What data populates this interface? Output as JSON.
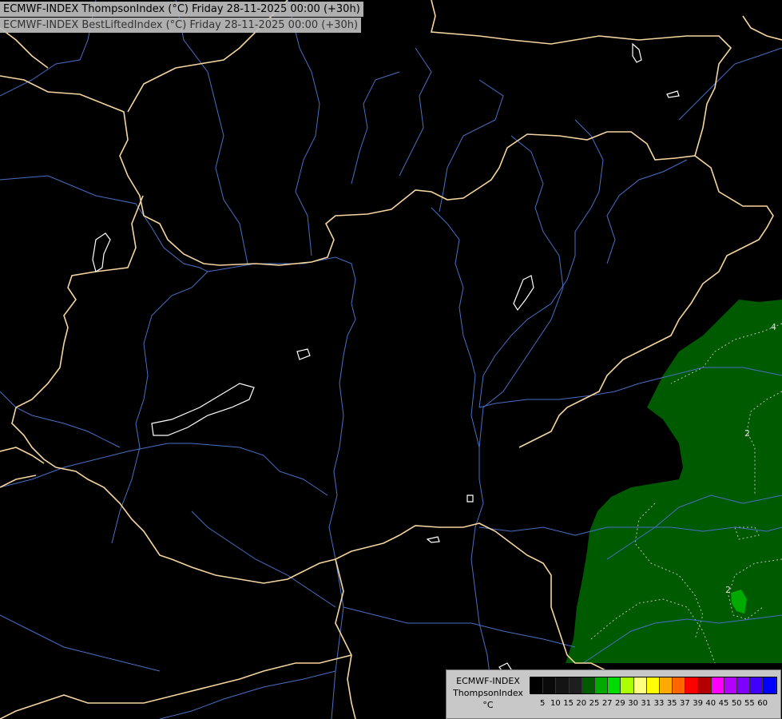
{
  "header": {
    "line1": "ECMWF-INDEX ThompsonIndex (°C) Friday 28-11-2025 00:00 (+30h)",
    "line2": "ECMWF-INDEX BestLiftedIndex (°C) Friday 28-11-2025 00:00 (+30h)"
  },
  "map": {
    "contour_labels": [
      "4",
      "2",
      "2"
    ],
    "colors": {
      "background": "#000000",
      "border": "#f5d5a0",
      "river": "#4a6fc4",
      "lake_outline": "#ffffff",
      "field_green": "#005a00",
      "field_bright_green": "#00aa00"
    }
  },
  "legend": {
    "model": "ECMWF-INDEX",
    "parameter": "ThompsonIndex",
    "unit": "°C",
    "colors": [
      "#000000",
      "#0a0a0a",
      "#141414",
      "#1e1e1e",
      "#005a00",
      "#00aa00",
      "#00dc00",
      "#aaff00",
      "#ffff80",
      "#ffff00",
      "#ffaa00",
      "#ff6600",
      "#ff0000",
      "#b40000",
      "#ff00ff",
      "#b400ff",
      "#8000ff",
      "#4000ff",
      "#0000ff"
    ],
    "ticks": [
      "5",
      "10",
      "15",
      "20",
      "25",
      "27",
      "29",
      "30",
      "31",
      "33",
      "35",
      "37",
      "39",
      "40",
      "45",
      "50",
      "55",
      "60"
    ]
  }
}
